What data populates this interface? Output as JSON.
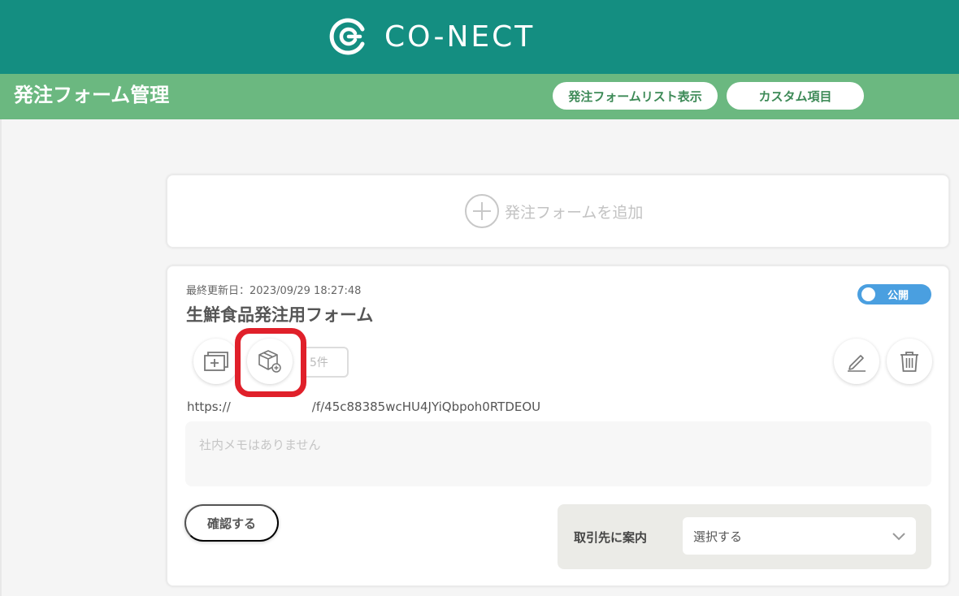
{
  "header": {
    "brand": "CO-NECT"
  },
  "subheader": {
    "title": "発注フォーム管理",
    "buttons": {
      "form_list": "発注フォームリスト表示",
      "custom_fields": "カスタム項目"
    }
  },
  "add_card": {
    "label": "発注フォームを追加"
  },
  "form_card": {
    "updated": "最終更新日：2023/09/29 18:27:48",
    "name": "生鮮食品発注用フォーム",
    "status": "公開",
    "item_count": "5件",
    "url_prefix": "https://",
    "url_suffix": "/f/45c88385wcHU4JYiQbpoh0RTDEOU",
    "memo_placeholder": "社内メモはありません",
    "confirm_label": "確認する",
    "invite_label": "取引先に案内",
    "invite_select_value": "選択する"
  },
  "colors": {
    "header": "#148e81",
    "subheader": "#6bb880",
    "toggle": "#4a9fe0",
    "highlight": "#e0202a"
  },
  "icons": [
    "logo-icon",
    "plus-circle-icon",
    "add-form-icon",
    "product-box-icon",
    "edit-icon",
    "trash-icon",
    "chevron-down-icon"
  ]
}
